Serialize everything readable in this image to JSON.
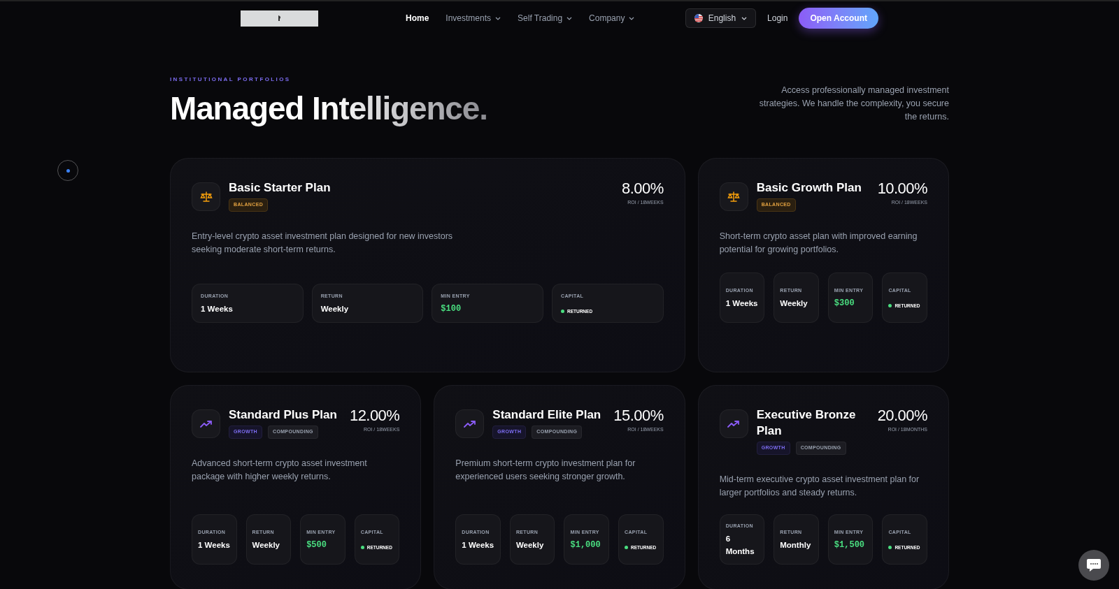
{
  "nav": {
    "links": [
      {
        "label": "Home",
        "selected": true,
        "dropdown": false
      },
      {
        "label": "Investments",
        "selected": false,
        "dropdown": true
      },
      {
        "label": "Self Trading",
        "selected": false,
        "dropdown": true
      },
      {
        "label": "Company",
        "selected": false,
        "dropdown": true
      }
    ],
    "language": "English",
    "login": "Login",
    "cta": "Open Account"
  },
  "hero": {
    "eyebrow": "INSTITUTIONAL PORTFOLIOS",
    "title": "Managed Intelligence.",
    "intro": "Access professionally managed investment strategies. We handle the complexity, you secure the returns."
  },
  "plans": [
    {
      "kind": "balanced",
      "wide": true,
      "name": "Basic Starter Plan",
      "tags": [
        {
          "label": "BALANCED",
          "kind": "balanced"
        }
      ],
      "roi": "8.00%",
      "period": "ROI / 18WEEKS",
      "description": "Entry-level crypto asset investment plan designed for new investors seeking moderate short-term returns.",
      "stats": [
        {
          "kind": "text",
          "label": "DURATION",
          "value": "1 Weeks"
        },
        {
          "kind": "text",
          "label": "RETURN",
          "value": "Weekly"
        },
        {
          "kind": "money",
          "label": "MIN ENTRY",
          "value": "$100"
        },
        {
          "kind": "status",
          "label": "CAPITAL",
          "value": "RETURNED"
        }
      ]
    },
    {
      "kind": "balanced",
      "wide": false,
      "name": "Basic Growth Plan",
      "tags": [
        {
          "label": "BALANCED",
          "kind": "balanced"
        }
      ],
      "roi": "10.00%",
      "period": "ROI / 18WEEKS",
      "description": "Short-term crypto asset plan with improved earning potential for growing portfolios.",
      "stats": [
        {
          "kind": "text",
          "label": "DURATION",
          "value": "1 Weeks"
        },
        {
          "kind": "text",
          "label": "RETURN",
          "value": "Weekly"
        },
        {
          "kind": "money",
          "label": "MIN ENTRY",
          "value": "$300"
        },
        {
          "kind": "status",
          "label": "CAPITAL",
          "value": "RETURNED"
        }
      ]
    },
    {
      "kind": "growth",
      "wide": false,
      "name": "Standard Plus Plan",
      "tags": [
        {
          "label": "GROWTH",
          "kind": "growth"
        },
        {
          "label": "COMPOUNDING",
          "kind": "compounding"
        }
      ],
      "roi": "12.00%",
      "period": "ROI / 18WEEKS",
      "description": "Advanced short-term crypto asset investment package with higher weekly returns.",
      "stats": [
        {
          "kind": "text",
          "label": "DURATION",
          "value": "1 Weeks"
        },
        {
          "kind": "text",
          "label": "RETURN",
          "value": "Weekly"
        },
        {
          "kind": "money",
          "label": "MIN ENTRY",
          "value": "$500"
        },
        {
          "kind": "status",
          "label": "CAPITAL",
          "value": "RETURNED"
        }
      ]
    },
    {
      "kind": "growth",
      "wide": false,
      "name": "Standard Elite Plan",
      "tags": [
        {
          "label": "GROWTH",
          "kind": "growth"
        },
        {
          "label": "COMPOUNDING",
          "kind": "compounding"
        }
      ],
      "roi": "15.00%",
      "period": "ROI / 18WEEKS",
      "description": "Premium short-term crypto investment plan for experienced users seeking stronger growth.",
      "stats": [
        {
          "kind": "text",
          "label": "DURATION",
          "value": "1 Weeks"
        },
        {
          "kind": "text",
          "label": "RETURN",
          "value": "Weekly"
        },
        {
          "kind": "money",
          "label": "MIN ENTRY",
          "value": "$1,000"
        },
        {
          "kind": "status",
          "label": "CAPITAL",
          "value": "RETURNED"
        }
      ]
    },
    {
      "kind": "growth",
      "wide": false,
      "name": "Executive Bronze Plan",
      "tags": [
        {
          "label": "GROWTH",
          "kind": "growth"
        },
        {
          "label": "COMPOUNDING",
          "kind": "compounding"
        }
      ],
      "roi": "20.00%",
      "period": "ROI / 18MONTHS",
      "description": "Mid-term executive crypto asset investment plan for larger portfolios and steady returns.",
      "stats": [
        {
          "kind": "text",
          "label": "DURATION",
          "value": "6 Months"
        },
        {
          "kind": "text",
          "label": "RETURN",
          "value": "Monthly"
        },
        {
          "kind": "money",
          "label": "MIN ENTRY",
          "value": "$1,500"
        },
        {
          "kind": "status",
          "label": "CAPITAL",
          "value": "RETURNED"
        }
      ]
    }
  ]
}
